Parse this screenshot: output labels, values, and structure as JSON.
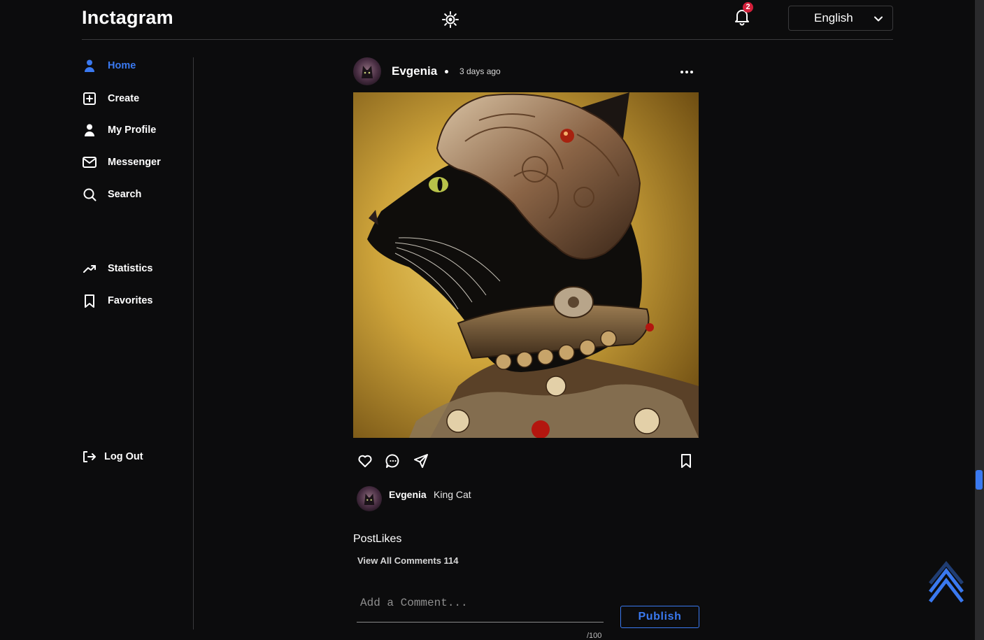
{
  "header": {
    "logo": "Inctagram",
    "notifications_count": "2",
    "language": "English"
  },
  "sidebar": {
    "items": [
      {
        "label": "Home",
        "icon": "person-icon",
        "active": true
      },
      {
        "label": "Create",
        "icon": "plus-square-icon"
      },
      {
        "label": "My Profile",
        "icon": "person-icon"
      },
      {
        "label": "Messenger",
        "icon": "mail-icon"
      },
      {
        "label": "Search",
        "icon": "search-icon"
      },
      {
        "label": "Statistics",
        "icon": "trending-up-icon"
      },
      {
        "label": "Favorites",
        "icon": "bookmark-icon"
      }
    ],
    "logout": "Log Out"
  },
  "post": {
    "author": "Evgenia",
    "time": "3 days ago",
    "image_alt": "cat",
    "caption_author": "Evgenia",
    "caption": "King Cat",
    "likes_label": "PostLikes",
    "view_comments": "View All Comments 114",
    "comment_placeholder": "Add a Comment...",
    "char_counter": "/100",
    "publish_label": "Publish"
  },
  "colors": {
    "accent": "#3a79f0",
    "badge": "#d31f3a",
    "background": "#0c0c0d"
  }
}
